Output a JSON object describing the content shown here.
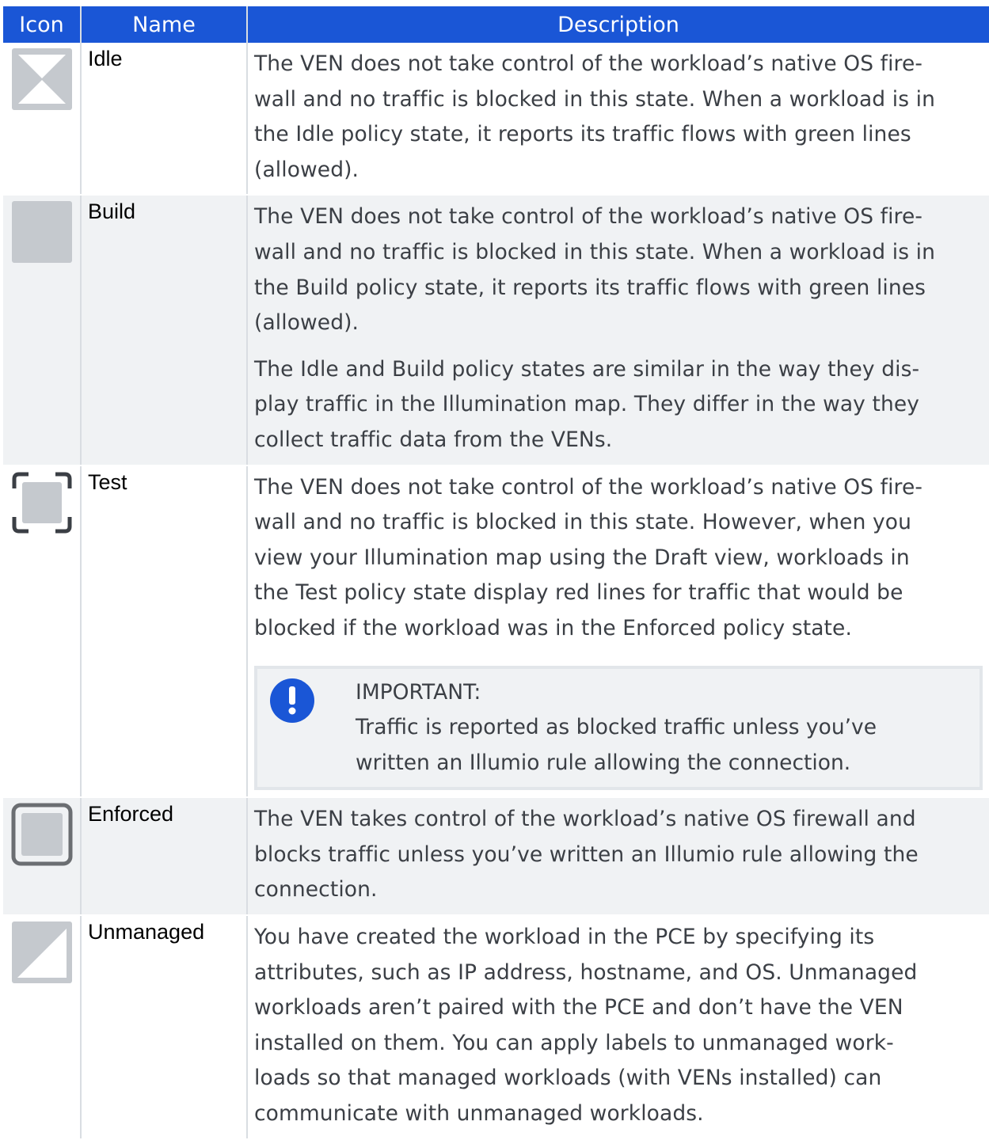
{
  "header": {
    "icon": "Icon",
    "name": "Name",
    "description": "Description"
  },
  "rows": [
    {
      "icon": "idle-state-icon",
      "name": "Idle",
      "paragraphs": [
        "The VEN does not take control of the workload’s native OS fire-\nwall and no traffic is blocked in this state. When a workload is in\nthe Idle policy state, it reports its traffic flows with green lines\n(allowed)."
      ]
    },
    {
      "icon": "build-state-icon",
      "name": "Build",
      "paragraphs": [
        "The VEN does not take control of the workload’s native OS fire-\nwall and no traffic is blocked in this state. When a workload is in\nthe Build policy state, it reports its traffic flows with green lines\n(allowed).",
        "The Idle and Build policy states are similar in the way they dis-\nplay traffic in the Illumination map. They differ in the way they\ncollect traffic data from the VENs."
      ]
    },
    {
      "icon": "test-state-icon",
      "name": "Test",
      "paragraphs": [
        "The VEN does not take control of the workload’s native OS fire-\nwall and no traffic is blocked in this state. However, when you\nview your Illumination map using the Draft view, workloads in\nthe Test policy state display red lines for traffic that would be\nblocked if the workload was in the Enforced policy state."
      ],
      "callout": {
        "icon": "important-icon",
        "title": "IMPORTANT:",
        "text": "Traffic is reported as blocked traffic unless you’ve\nwritten an Illumio rule allowing the connection."
      }
    },
    {
      "icon": "enforced-state-icon",
      "name": "Enforced",
      "paragraphs": [
        "The VEN takes control of the workload’s native OS firewall and\nblocks traffic unless you’ve written an Illumio rule allowing the\nconnection."
      ]
    },
    {
      "icon": "unmanaged-state-icon",
      "name": "Unmanaged",
      "paragraphs": [
        "You have created the workload in the PCE by specifying its\nattributes, such as IP address, hostname, and OS. Unmanaged\nworkloads aren’t paired with the PCE and don’t have the VEN\ninstalled on them. You can apply labels to unmanaged work-\nloads so that managed workloads (with VENs installed) can\ncommunicate with unmanaged workloads."
      ]
    }
  ],
  "colors": {
    "header_bg": "#1a56d6",
    "row_alt_bg": "#f0f2f4",
    "icon_grey": "#c5c9ce",
    "enforced_border": "#6b6e72",
    "callout_icon": "#1a56d6"
  }
}
